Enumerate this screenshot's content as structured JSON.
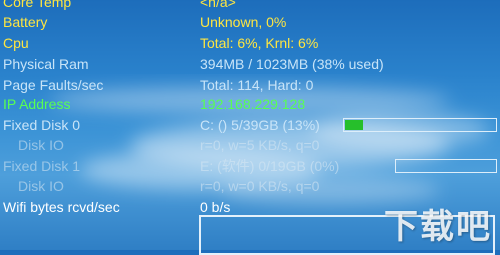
{
  "stats": [
    {
      "label": "Core Temp",
      "value": "<n/a>",
      "color": "yellow"
    },
    {
      "label": "Battery",
      "value": "Unknown, 0%",
      "color": "yellow"
    },
    {
      "label": "Cpu",
      "value": "Total: 6%, Krnl: 6%",
      "color": "yellow"
    },
    {
      "label": "Physical Ram",
      "value": "394MB / 1023MB (38% used)",
      "color": "light"
    },
    {
      "label": "Page Faults/sec",
      "value": "Total: 114, Hard: 0",
      "color": "light"
    },
    {
      "label": "IP Address",
      "value": "192.168.229.128",
      "color": "green"
    },
    {
      "label": "Fixed Disk 0",
      "value": "C: () 5/39GB (13%)",
      "color": "light",
      "disk_usage_percent": 13
    },
    {
      "label": "Disk IO",
      "value": "r=0, w=5 KB/s, q=0",
      "color": "faint"
    },
    {
      "label": "Fixed Disk 1",
      "value": "E: (软件) 0/19GB (0%)",
      "color": "faint",
      "disk_usage_percent": 0
    },
    {
      "label": "Disk IO",
      "value": "r=0, w=0 KB/s, q=0",
      "color": "faint"
    },
    {
      "label": "Wifi bytes rcvd/sec",
      "value": "0 b/s",
      "color": "white"
    }
  ],
  "watermark": "下载吧",
  "colors": {
    "yellow": "#ffe640",
    "light": "#c8e4f8",
    "green": "#58ff52",
    "white": "#ffffff",
    "disk_fill": "#26bf2b"
  }
}
